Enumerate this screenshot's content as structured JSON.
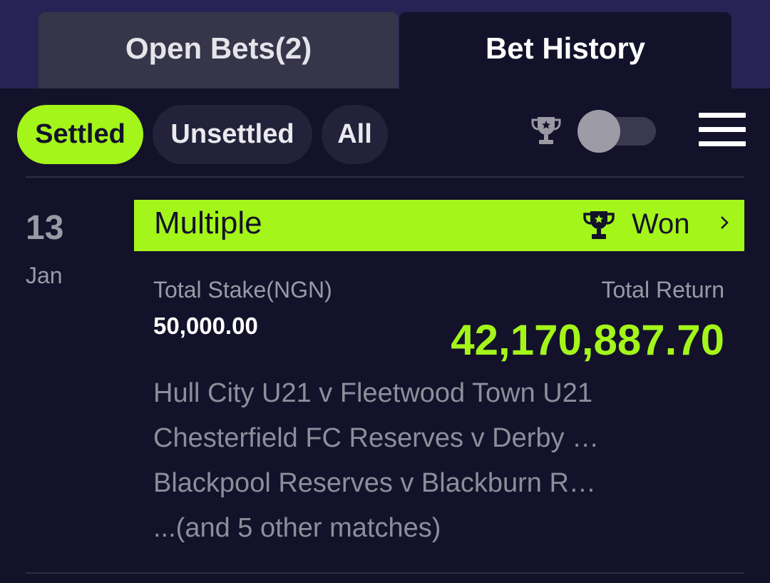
{
  "tabs": [
    {
      "label": "Open Bets(2)",
      "active": false
    },
    {
      "label": "Bet History",
      "active": true
    }
  ],
  "filters": [
    {
      "label": "Settled",
      "active": true
    },
    {
      "label": "Unsettled",
      "active": false
    },
    {
      "label": "All",
      "active": false
    }
  ],
  "toolbar": {
    "trophy_icon": "trophy-star-icon",
    "toggle_on": false,
    "menu_icon": "hamburger-menu-icon"
  },
  "bet": {
    "date_day": "13",
    "date_month": "Jan",
    "type": "Multiple",
    "status": "Won",
    "status_icon": "trophy-star-icon",
    "stake_label": "Total Stake(NGN)",
    "stake_value": "50,000.00",
    "return_label": "Total Return",
    "return_value": "42,170,887.70",
    "matches": [
      "Hull City U21 v Fleetwood Town U21",
      "Chesterfield FC Reserves v Derby …",
      "Blackpool Reserves v Blackburn R…",
      "...(and 5 other matches)"
    ]
  },
  "colors": {
    "accent": "#a4f51a",
    "background": "#13122a",
    "header_bar": "#272354"
  }
}
